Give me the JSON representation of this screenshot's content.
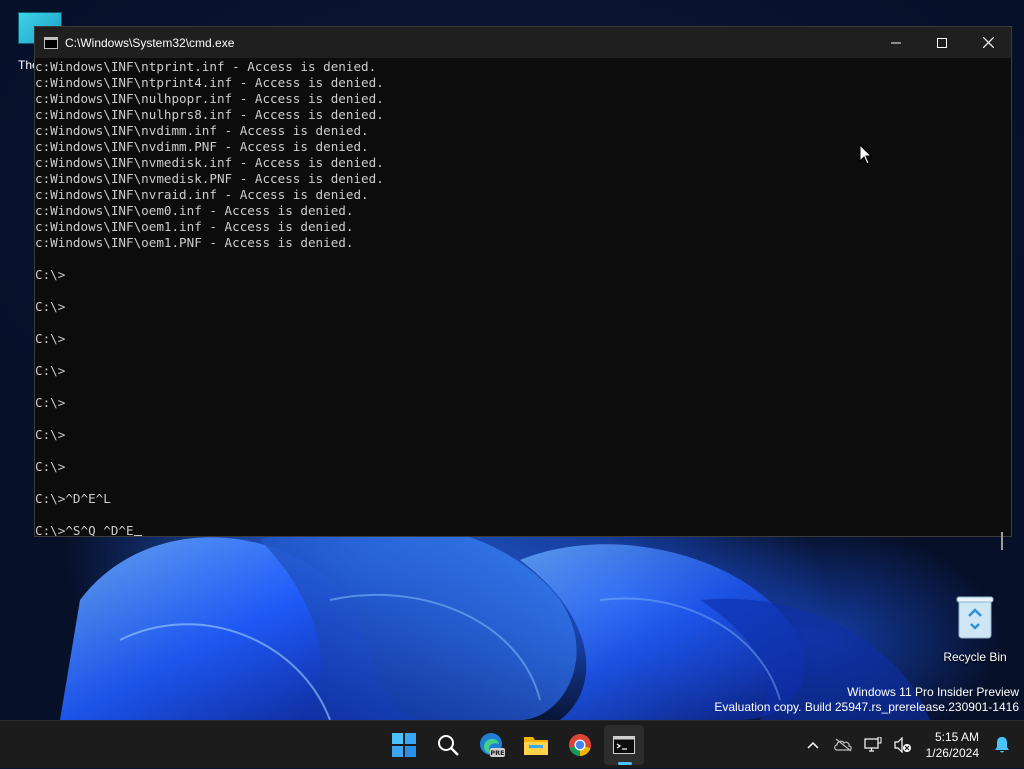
{
  "desktop": {
    "top_icon_label_partial": "The",
    "recycle_bin_label": "Recycle Bin",
    "watermark": {
      "line1": "Windows 11 Pro Insider Preview",
      "line2": "Evaluation copy. Build 25947.rs_prerelease.230901-1416"
    }
  },
  "cmd_window": {
    "title": "C:\\Windows\\System32\\cmd.exe",
    "lines": [
      "c:Windows\\INF\\ntprint.inf - Access is denied.",
      "c:Windows\\INF\\ntprint4.inf - Access is denied.",
      "c:Windows\\INF\\nulhpopr.inf - Access is denied.",
      "c:Windows\\INF\\nulhprs8.inf - Access is denied.",
      "c:Windows\\INF\\nvdimm.inf - Access is denied.",
      "c:Windows\\INF\\nvdimm.PNF - Access is denied.",
      "c:Windows\\INF\\nvmedisk.inf - Access is denied.",
      "c:Windows\\INF\\nvmedisk.PNF - Access is denied.",
      "c:Windows\\INF\\nvraid.inf - Access is denied.",
      "c:Windows\\INF\\oem0.inf - Access is denied.",
      "c:Windows\\INF\\oem1.inf - Access is denied.",
      "c:Windows\\INF\\oem1.PNF - Access is denied.",
      "",
      "C:\\>",
      "",
      "C:\\>",
      "",
      "C:\\>",
      "",
      "C:\\>",
      "",
      "C:\\>",
      "",
      "C:\\>",
      "",
      "C:\\>",
      "",
      "C:\\>^D^E^L",
      ""
    ],
    "current_input": "C:\\>^S^Q ^D^E"
  },
  "taskbar": {
    "items": [
      "start-icon",
      "search-icon",
      "edge-pre-icon",
      "file-explorer-icon",
      "chrome-icon",
      "terminal-icon"
    ],
    "edge_badge": "PRE",
    "clock": {
      "time": "5:15 AM",
      "date": "1/26/2024"
    }
  },
  "colors": {
    "terminal_bg": "#0c0c0c",
    "terminal_fg": "#cccccc",
    "taskbar_bg": "#1c1c1c",
    "accent": "#4cc2ff"
  }
}
